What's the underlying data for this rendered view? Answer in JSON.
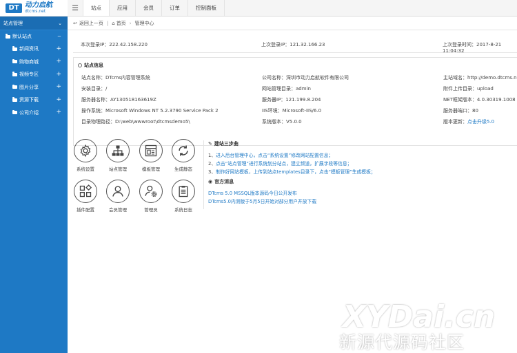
{
  "logo": {
    "badge": "DT",
    "title_cn": "动力启航",
    "title_en": "dtcms.net"
  },
  "topnav": {
    "tabs": [
      "站点",
      "应用",
      "会员",
      "订单",
      "控制面板"
    ]
  },
  "sidebar": {
    "header": "站点管理",
    "subheader": "默认站点",
    "items": [
      "新闻资讯",
      "购物商城",
      "视频专区",
      "图片分享",
      "资源下载",
      "公司介绍"
    ]
  },
  "breadcrumb": {
    "back": "返回上一页",
    "home": "首页",
    "current": "管理中心"
  },
  "login": {
    "this_ip": "本次登录IP：222.42.158.220",
    "last_ip": "上次登录IP：121.32.166.23",
    "last_time": "上次登录时间：2017-8-21 11:04:32"
  },
  "site_info": {
    "title": "站点信息",
    "rows": [
      [
        "站点名称：DTcms内容管理系统",
        "公司名称：深圳市动力启航软件有限公司",
        "主站域名：http://demo.dtcms.net"
      ],
      [
        "安装目录：/",
        "网站管理目录：admin",
        "附件上传目录：upload"
      ],
      [
        "服务器名称：AY130518163619Z",
        "服务器IP：121.199.8.204",
        "NET框架版本：4.0.30319.1008"
      ],
      [
        "操作系统：Microsoft Windows NT 5.2.3790 Service Pack 2",
        "IIS环境：Microsoft-IIS/6.0",
        "服务器端口：80"
      ],
      [
        "目录物理路径：D:\\web\\wwwroot\\dtcmsdemo5\\",
        "系统版本：V5.0.0",
        "版本更新："
      ]
    ],
    "upgrade_link": "点击升级5.0"
  },
  "shortcuts": [
    {
      "label": "系统设置",
      "icon": "gear-icon"
    },
    {
      "label": "站点管理",
      "icon": "sitemap-icon"
    },
    {
      "label": "模板管理",
      "icon": "template-icon"
    },
    {
      "label": "生成静态",
      "icon": "refresh-icon"
    },
    {
      "label": "插件配置",
      "icon": "plugin-icon"
    },
    {
      "label": "会员管理",
      "icon": "user-icon"
    },
    {
      "label": "管理员",
      "icon": "admin-gear-icon"
    },
    {
      "label": "系统日志",
      "icon": "clipboard-icon"
    }
  ],
  "steps": {
    "title": "建站三步曲",
    "lines": [
      [
        "1、",
        "进入后台管理中心，点击“系统设置”修改网站配置信息；"
      ],
      [
        "2、",
        "点击“站点管理”进行系统划分站点，建立频道，扩展字段等信息；"
      ],
      [
        "3、",
        "制作好网站模板，上传到站点templates目录下，点击“模板管理”生成模板；"
      ]
    ]
  },
  "news": {
    "title": "官方消息",
    "lines": [
      "DTcms 5.0 MSSQL版本源码今日公开发布",
      "DTcms5.0内测版于5月5日开始对部分用户开放下载"
    ]
  },
  "watermark": {
    "top": "XYDai.cn",
    "bottom": "新源代源码社区"
  },
  "colors": {
    "accent": "#1e79c5",
    "sidebar": "#1e79c5"
  }
}
